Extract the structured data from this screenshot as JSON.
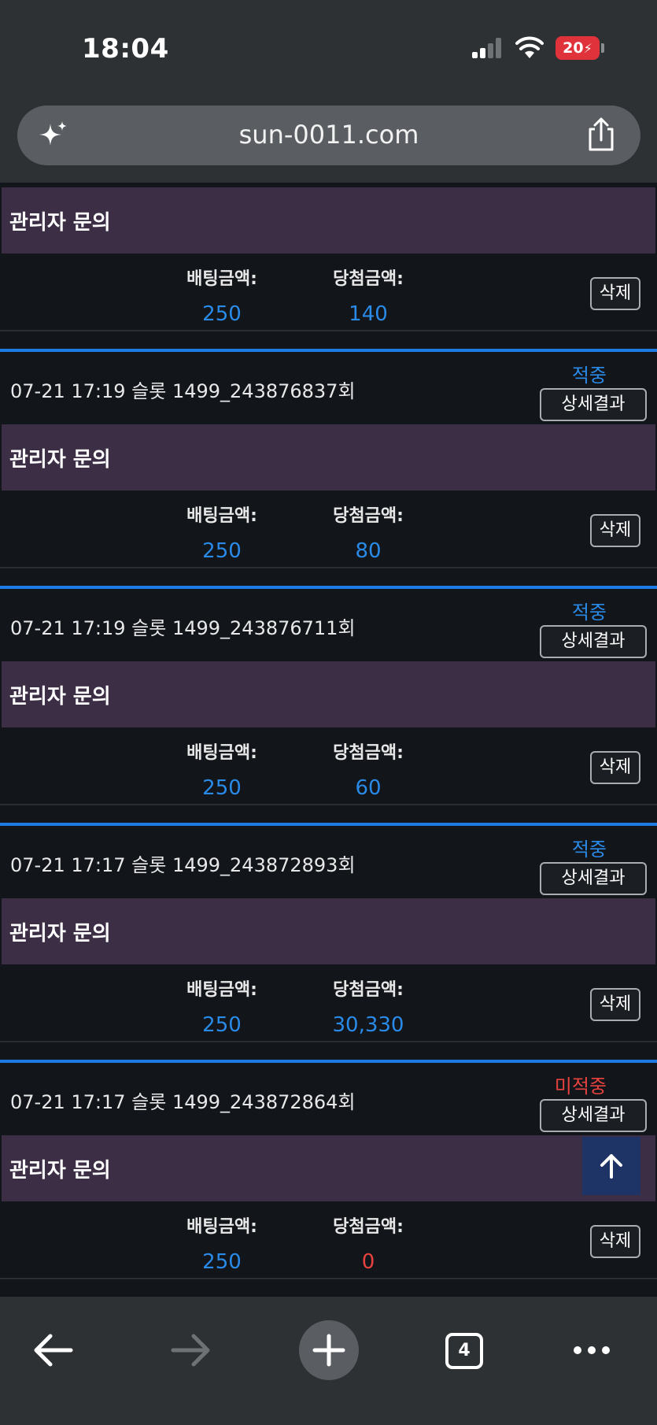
{
  "status_bar": {
    "time": "18:04",
    "battery": "20"
  },
  "browser": {
    "url": "sun-0011.com",
    "tab_count": "4"
  },
  "labels": {
    "admin_inquiry": "관리자 문의",
    "bet_amount": "배팅금액:",
    "win_amount": "당첨금액:",
    "detail_button": "상세결과",
    "delete_button": "삭제"
  },
  "top_partial": {
    "bet_value": "250",
    "win_value": "140"
  },
  "entries": [
    {
      "title": "07-21 17:19  슬롯 1499_243876837회",
      "status": "적중",
      "bet_value": "250",
      "win_value": "80"
    },
    {
      "title": "07-21 17:19  슬롯 1499_243876711회",
      "status": "적중",
      "bet_value": "250",
      "win_value": "60"
    },
    {
      "title": "07-21 17:17  슬롯 1499_243872893회",
      "status": "적중",
      "bet_value": "250",
      "win_value": "30,330"
    },
    {
      "title": "07-21 17:17  슬롯 1499_243872864회",
      "status": "미적중",
      "bet_value": "250",
      "win_value": "0"
    }
  ],
  "colors": {
    "accent": "#1e7be6",
    "win": "#2a8ae8",
    "lose": "#e8423e",
    "admin_bg": "#3b2e45"
  }
}
